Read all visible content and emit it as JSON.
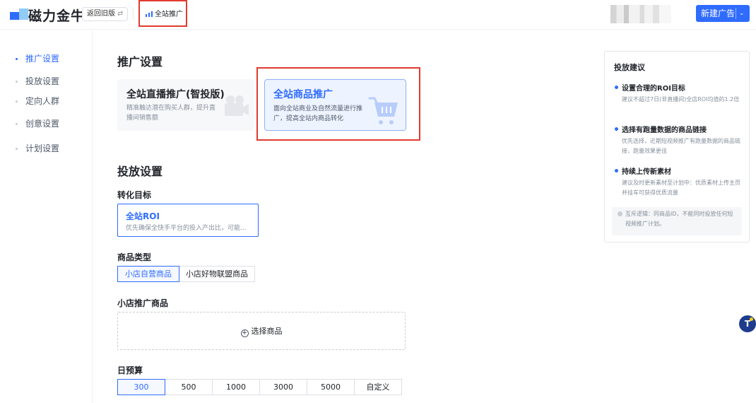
{
  "header": {
    "logo_text": "磁力金牛",
    "back_label": "返回旧版",
    "back_icon": "⇄",
    "current_tab": "全站推广",
    "new_ad_label": "新建广告",
    "new_ad_caret": "⌄"
  },
  "nav": {
    "items": [
      {
        "label": "推广设置",
        "active": true
      },
      {
        "label": "投放设置",
        "active": false
      },
      {
        "label": "定向人群",
        "active": false
      },
      {
        "label": "创意设置",
        "active": false
      },
      {
        "label": "计划设置",
        "active": false
      }
    ]
  },
  "promo": {
    "title": "推广设置",
    "cards": [
      {
        "title": "全站直播推广(智投版)",
        "desc": "精准触达潜在购买人群，提升直播间销售额",
        "icon": "camera-icon",
        "selected": false
      },
      {
        "title": "全站商品推广",
        "desc": "面向全站商业及自然流量进行推广，提高全站内商品转化",
        "icon": "shopping-cart-icon",
        "selected": true
      }
    ]
  },
  "delivery": {
    "title": "投放设置",
    "goal_label": "转化目标",
    "goal": {
      "title": "全站ROI",
      "desc": "优先确保全快手平台的投入产出比，可能..."
    },
    "product_type_label": "商品类型",
    "product_types": [
      {
        "label": "小店自营商品",
        "selected": true
      },
      {
        "label": "小店好物联盟商品",
        "selected": false
      }
    ],
    "product_label": "小店推广商品",
    "pick_label": "选择商品",
    "budget_label": "日预算",
    "budgets": [
      {
        "label": "300",
        "selected": true
      },
      {
        "label": "500",
        "selected": false
      },
      {
        "label": "1000",
        "selected": false
      },
      {
        "label": "3000",
        "selected": false
      },
      {
        "label": "5000",
        "selected": false
      },
      {
        "label": "自定义",
        "selected": false
      }
    ]
  },
  "advice": {
    "title": "投放建议",
    "tips": [
      {
        "heading": "设置合理的ROI目标",
        "body": "建议不超过7日(非直播间)全店ROI均值的1.2倍"
      },
      {
        "heading": "选择有跑量数据的商品链接",
        "body": "优先选择，近期短视频推广有跑量数据的商品链接，跑量效果更佳"
      },
      {
        "heading": "持续上传新素材",
        "body": "建议及时更新素材至计划中：优质素材上传主页并挂车可获得优质流量"
      }
    ],
    "note": "互斥逻辑：同商品ID，不能同时投放任何短视频推广计划。"
  },
  "colors": {
    "accent": "#2f6bff",
    "highlight_box": "#e03a2f"
  }
}
